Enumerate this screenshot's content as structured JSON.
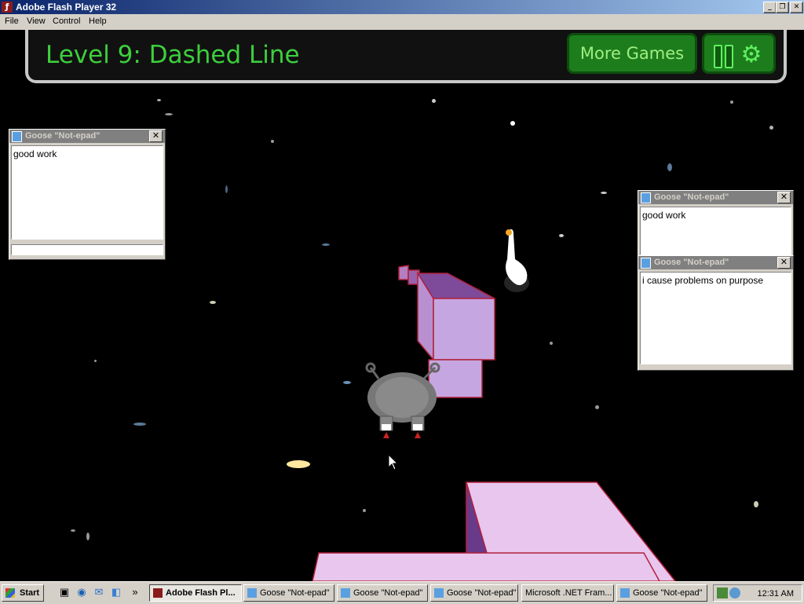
{
  "window": {
    "title": "Adobe Flash Player 32",
    "controls": [
      "_",
      "❐",
      "✕"
    ]
  },
  "menu": [
    "File",
    "View",
    "Control",
    "Help"
  ],
  "game": {
    "level_title": "Level 9: Dashed Line",
    "more_games_label": "More Games",
    "settings_icon": "⚙"
  },
  "notepads": [
    {
      "title": "Goose \"Not-epad\"",
      "text": "good work"
    },
    {
      "title": "Goose \"Not-epad\"",
      "text": "good work"
    },
    {
      "title": "Goose \"Not-epad\"",
      "text": "i cause problems on purpose"
    }
  ],
  "taskbar": {
    "start_label": "Start",
    "quicklaunch": [
      "▣",
      "◉",
      "✉",
      "◧"
    ],
    "more": "»",
    "tasks": [
      {
        "label": "Adobe Flash Pl...",
        "active": true
      },
      {
        "label": "Goose \"Not-epad\"",
        "active": false
      },
      {
        "label": "Goose \"Not-epad\"",
        "active": false
      },
      {
        "label": "Goose \"Not-epad\"",
        "active": false
      },
      {
        "label": "Microsoft .NET Fram...",
        "active": false
      },
      {
        "label": "Goose \"Not-epad\"",
        "active": false
      }
    ],
    "clock": "12:31 AM"
  }
}
